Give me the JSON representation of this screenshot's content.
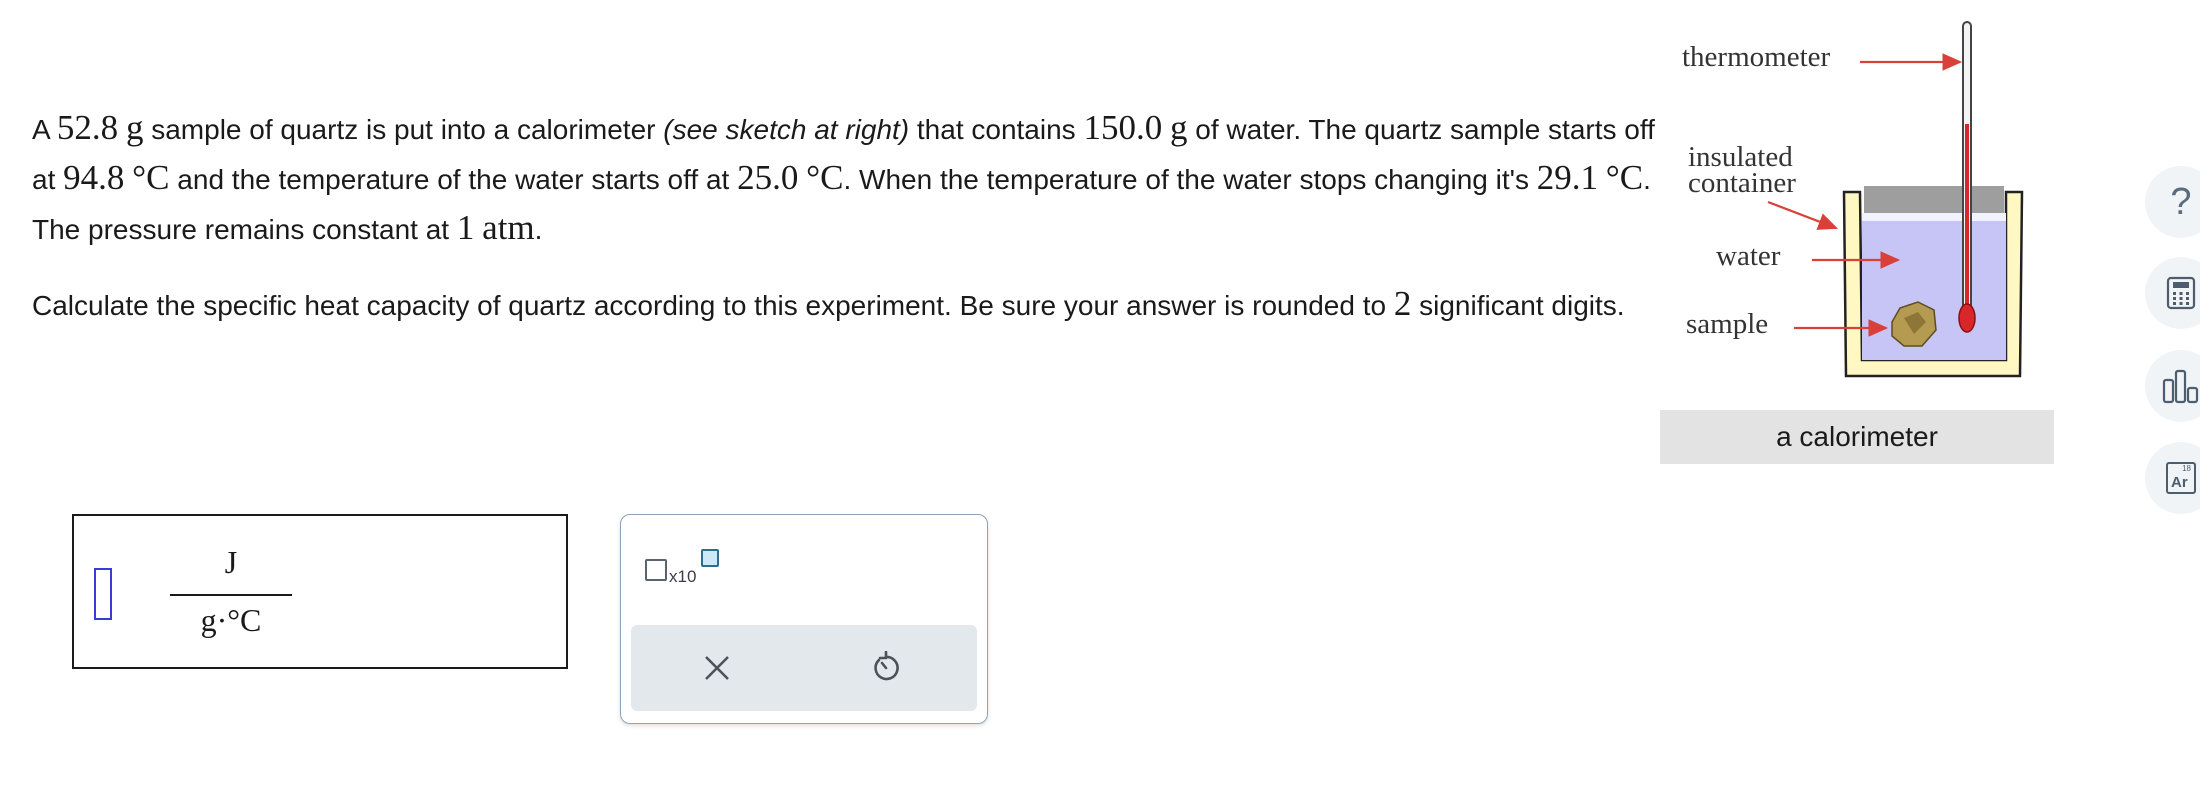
{
  "problem": {
    "p1": {
      "t1": "A ",
      "mass_sample": "52.8",
      "unit_g1": "g",
      "t2": " sample of quartz is put into a calorimeter ",
      "sketch_note": "(see sketch at right)",
      "t3": " that contains ",
      "mass_water": "150.0",
      "unit_g2": "g",
      "t4": " of water. The quartz sample starts off at ",
      "temp_sample": "94.8",
      "unit_c1": "°C",
      "t5": " and the temperature of the water starts off at ",
      "temp_water": "25.0",
      "unit_c2": "°C",
      "t6": ". When the temperature of the water stops changing it's ",
      "temp_final": "29.1",
      "unit_c3": "°C",
      "t7": ". The pressure remains constant at ",
      "pressure": "1",
      "unit_atm": "atm",
      "t8": "."
    },
    "p2": {
      "t1": "Calculate the specific heat capacity of quartz according to this experiment. Be sure your answer is rounded to ",
      "digits": "2",
      "t2": " significant digits."
    }
  },
  "answer": {
    "value": "",
    "unit_numerator": "J",
    "unit_denominator": "g·°C"
  },
  "keypad": {
    "sci_label": "x10",
    "clear_symbol": "✕",
    "undo_symbol": "↺",
    "icons": [
      "scientific-notation-icon",
      "clear-icon",
      "undo-icon"
    ]
  },
  "figure": {
    "label_thermometer": "thermometer",
    "label_container_1": "insulated",
    "label_container_2": "container",
    "label_water": "water",
    "label_sample": "sample",
    "caption": "a calorimeter",
    "colors": {
      "arrow": "#d9403a",
      "water": "#c7c5f5",
      "container": "#fff8c2",
      "lid": "#9e9e9e",
      "mercury": "#d9262a",
      "sample": "#b59a52"
    }
  },
  "toolbar": {
    "help_symbol": "?",
    "periodic_mass": "18",
    "periodic_symbol": "Ar",
    "icons": [
      "help-icon",
      "calculator-icon",
      "data-chart-icon",
      "periodic-table-icon"
    ]
  }
}
